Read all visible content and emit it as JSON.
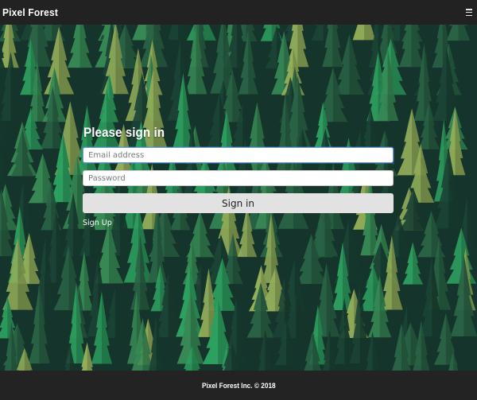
{
  "header": {
    "brand": "Pixel Forest"
  },
  "signin": {
    "title": "Please sign in",
    "email_placeholder": "Email address",
    "password_placeholder": "Password",
    "submit_label": "Sign in",
    "signup_label": "Sign Up"
  },
  "footer": {
    "text": "Pixel Forest Inc. © 2018"
  },
  "icons": {
    "menu": "hamburger-menu-icon"
  },
  "colors": {
    "navbar": "#222222",
    "footer": "#232323",
    "forest_base": "#17382e",
    "tree_dark": "#1e4a3a",
    "tree_mid": "#2f6e4c",
    "tree_light": "#3f9a5e",
    "tree_bright": "#33b36a",
    "tree_yellow": "#a8c464",
    "button": "#e2e2e2"
  }
}
